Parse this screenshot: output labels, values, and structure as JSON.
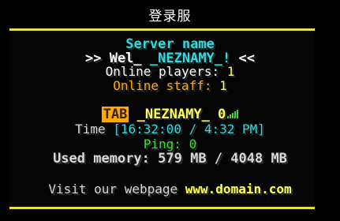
{
  "window": {
    "title": "登录服"
  },
  "scoreboard": {
    "server_name": "Server name",
    "welcome_prefix": ">> Wel_",
    "welcome_player": "_NEZNAMY_!",
    "welcome_suffix": "<<",
    "online_players_label": "Online players:",
    "online_players_value": "1",
    "online_staff_label": "Online staff:",
    "online_staff_value": "1",
    "tab_tag": "TAB",
    "tab_player": "_NEZNAMY_",
    "tab_score": "0",
    "time_label": "Time",
    "time_value": "[16:32:00 / 4:32 PM]",
    "ping_label": "Ping:",
    "ping_value": "0",
    "memory_label": "Used memory:",
    "memory_value": "579 MB / 4048 MB",
    "visit_label": "Visit our webpage",
    "visit_url": "www.domain.com"
  },
  "colors": {
    "accent_rule": "#e8e040",
    "aqua": "#33d9e0",
    "gold": "#ffaa00",
    "green": "#33e033",
    "yellow": "#ffff55"
  },
  "icons": {
    "ping": "signal-bars-icon"
  }
}
